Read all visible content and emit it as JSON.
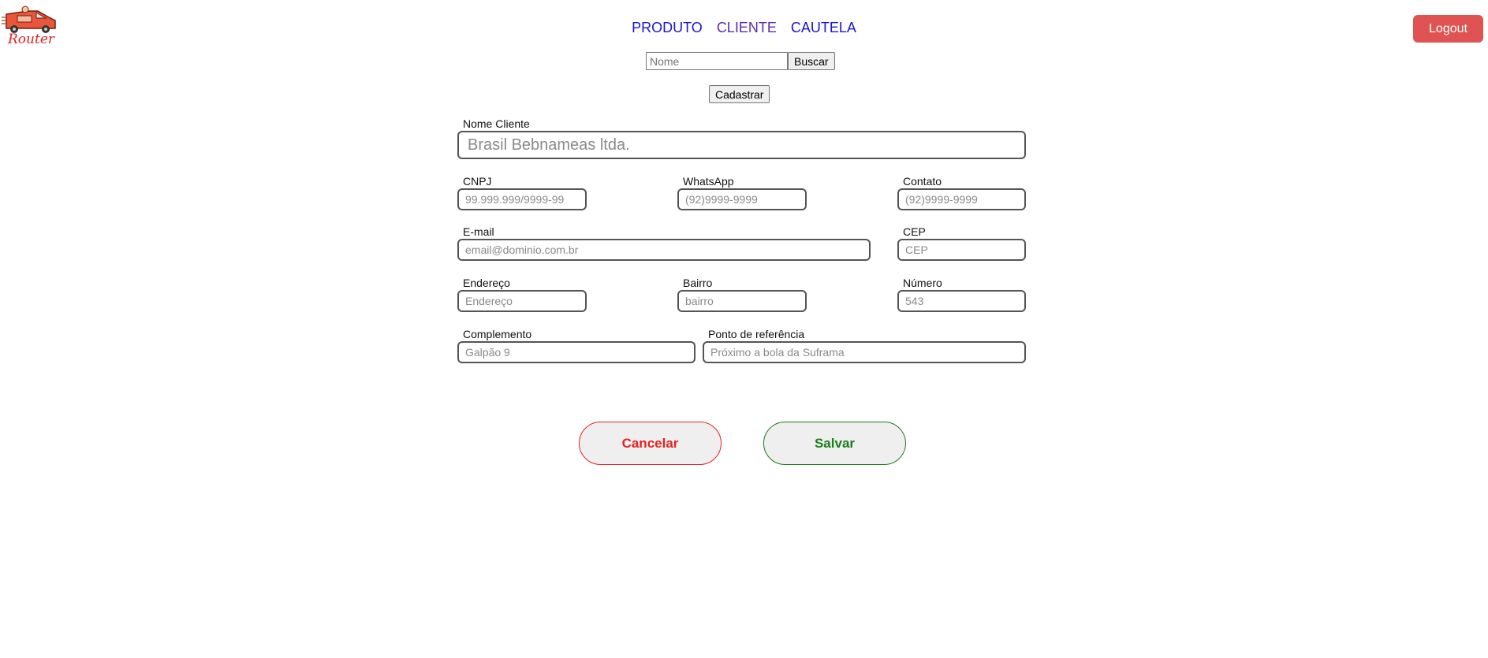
{
  "brand": {
    "logo_text": "Router"
  },
  "nav": {
    "items": [
      {
        "label": "PRODUTO"
      },
      {
        "label": "CLIENTE"
      },
      {
        "label": "CAUTELA"
      }
    ]
  },
  "header": {
    "logout_label": "Logout"
  },
  "search": {
    "placeholder": "Nome",
    "value": "",
    "button_label": "Buscar"
  },
  "actions": {
    "register_label": "Cadastrar",
    "cancel_label": "Cancelar",
    "save_label": "Salvar"
  },
  "form": {
    "nome_cliente": {
      "label": "Nome Cliente",
      "placeholder": "Brasil Bebnameas ltda."
    },
    "cnpj": {
      "label": "CNPJ",
      "placeholder": "99.999.999/9999-99"
    },
    "whatsapp": {
      "label": "WhatsApp",
      "placeholder": "(92)9999-9999"
    },
    "contato": {
      "label": "Contato",
      "placeholder": "(92)9999-9999"
    },
    "email": {
      "label": "E-mail",
      "placeholder": "email@dominio.com.br"
    },
    "cep": {
      "label": "CEP",
      "placeholder": "CEP"
    },
    "endereco": {
      "label": "Endereço",
      "placeholder": "Endereço"
    },
    "bairro": {
      "label": "Bairro",
      "placeholder": "bairro"
    },
    "numero": {
      "label": "Número",
      "placeholder": "543"
    },
    "complemento": {
      "label": "Complemento",
      "placeholder": "Galpão 9"
    },
    "referencia": {
      "label": "Ponto de referência",
      "placeholder": "Próximo a bola da Suframa"
    }
  }
}
